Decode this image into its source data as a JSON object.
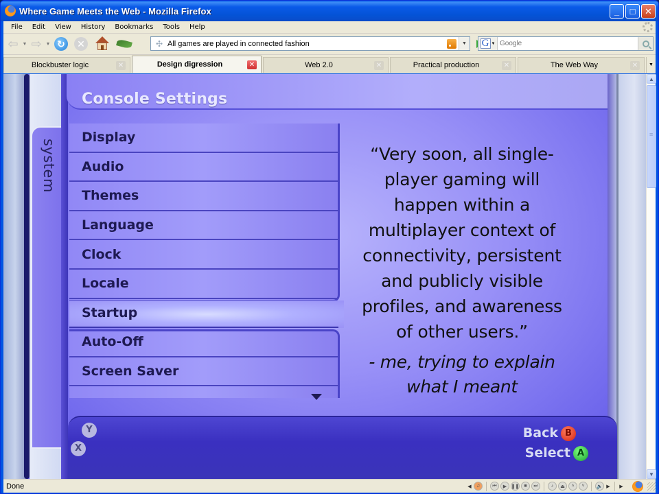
{
  "window": {
    "title": "Where Game Meets the Web - Mozilla Firefox",
    "controls": {
      "minimize": "_",
      "maximize": "□",
      "close": "✕"
    }
  },
  "menubar": {
    "items": [
      {
        "label": "File",
        "key": "F"
      },
      {
        "label": "Edit",
        "key": "E"
      },
      {
        "label": "View",
        "key": "V"
      },
      {
        "label": "History",
        "key": "s"
      },
      {
        "label": "Bookmarks",
        "key": "B"
      },
      {
        "label": "Tools",
        "key": "T"
      },
      {
        "label": "Help",
        "key": "H"
      }
    ]
  },
  "navbar": {
    "back_icon": "back-arrow-icon",
    "forward_icon": "forward-arrow-icon",
    "url": "All games are played in connected fashion",
    "search_placeholder": "Google",
    "search_engine": "G"
  },
  "tabs": [
    {
      "label": "Blockbuster logic",
      "active": false
    },
    {
      "label": "Design digression",
      "active": true
    },
    {
      "label": "Web 2.0",
      "active": false
    },
    {
      "label": "Practical production",
      "active": false
    },
    {
      "label": "The Web Way",
      "active": false
    }
  ],
  "slide": {
    "blade_label": "system",
    "title": "Console Settings",
    "menu_items": [
      "Display",
      "Audio",
      "Themes",
      "Language",
      "Clock",
      "Locale",
      "Startup",
      "Auto-Off",
      "Screen Saver"
    ],
    "selected_item": "Startup",
    "quote": "“Very soon, all single-player gaming will happen within a multiplayer context of connectivity, persistent and publicly visible profiles, and awareness of other users.”",
    "quote_lines": [
      "“Very soon, all single-",
      "player gaming will",
      "happen within a",
      "multiplayer context of",
      "connectivity, persistent",
      "and publicly visible",
      "profiles, and awareness",
      "of other users.”"
    ],
    "attribution_lines": [
      "- me, trying to explain",
      "what I meant"
    ],
    "buttons": {
      "y": "Y",
      "x": "X",
      "b": "B",
      "a": "A",
      "back_label": "Back",
      "select_label": "Select"
    },
    "colors": {
      "background": "#9890f7",
      "menu_text": "#1e1a52",
      "footer": "#3a30c0",
      "b_button": "#d42010",
      "a_button": "#18a030"
    }
  },
  "statusbar": {
    "text": "Done"
  }
}
